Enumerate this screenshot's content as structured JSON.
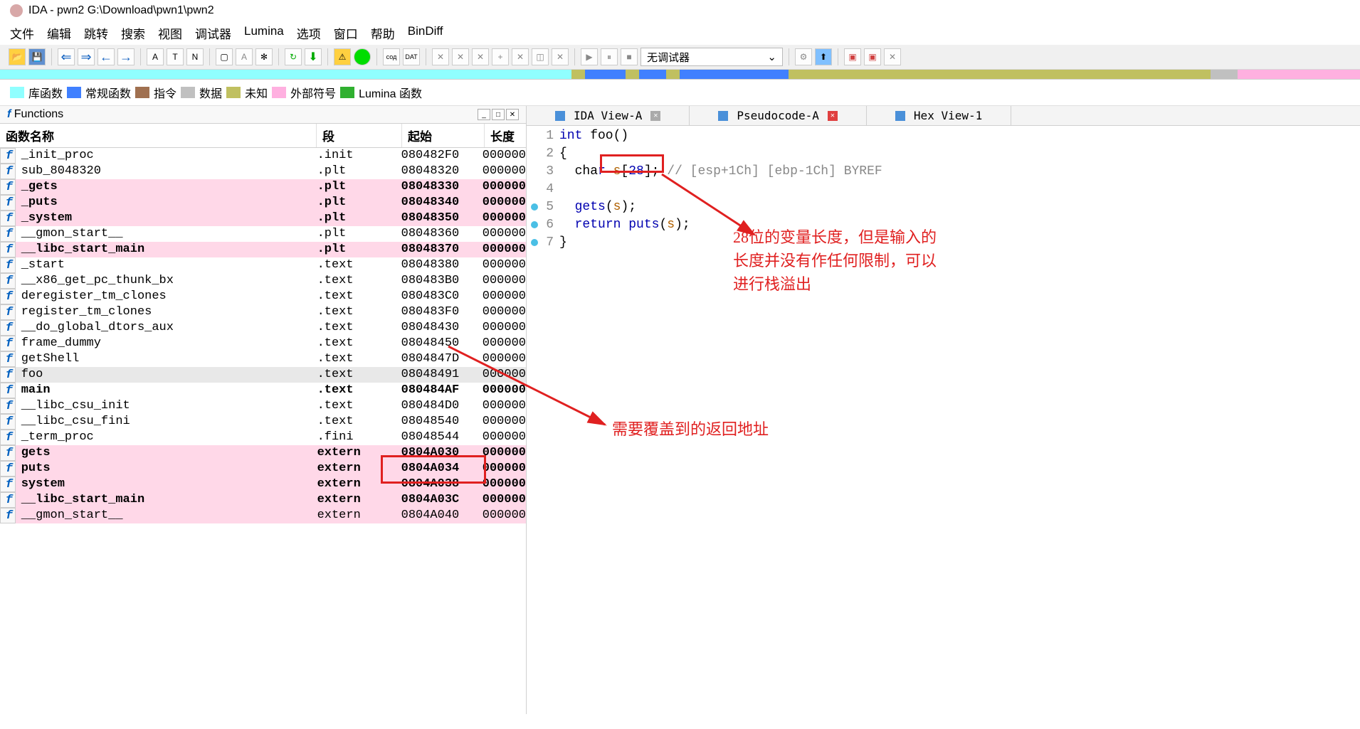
{
  "title": "IDA - pwn2 G:\\Download\\pwn1\\pwn2",
  "menu": [
    "文件",
    "编辑",
    "跳转",
    "搜索",
    "视图",
    "调试器",
    "Lumina",
    "选项",
    "窗口",
    "帮助",
    "BinDiff"
  ],
  "debugger_select": "无调试器",
  "legend": [
    {
      "color": "#90ffff",
      "label": "库函数"
    },
    {
      "color": "#4080ff",
      "label": "常规函数"
    },
    {
      "color": "#a07050",
      "label": "指令"
    },
    {
      "color": "#c0c0c0",
      "label": "数据"
    },
    {
      "color": "#c0c060",
      "label": "未知"
    },
    {
      "color": "#ffb0e0",
      "label": "外部符号"
    },
    {
      "color": "#30b030",
      "label": "Lumina 函数"
    }
  ],
  "functions_panel": {
    "title": "Functions",
    "headers": {
      "name": "函数名称",
      "seg": "段",
      "start": "起始",
      "len": "长度"
    }
  },
  "functions": [
    {
      "name": "_init_proc",
      "seg": ".init",
      "start": "080482F0",
      "len": "000000",
      "pink": false,
      "bold": false
    },
    {
      "name": "sub_8048320",
      "seg": ".plt",
      "start": "08048320",
      "len": "000000",
      "pink": false,
      "bold": false
    },
    {
      "name": "_gets",
      "seg": ".plt",
      "start": "08048330",
      "len": "000000",
      "pink": true,
      "bold": true
    },
    {
      "name": "_puts",
      "seg": ".plt",
      "start": "08048340",
      "len": "000000",
      "pink": true,
      "bold": true
    },
    {
      "name": "_system",
      "seg": ".plt",
      "start": "08048350",
      "len": "000000",
      "pink": true,
      "bold": true
    },
    {
      "name": "__gmon_start__",
      "seg": ".plt",
      "start": "08048360",
      "len": "000000",
      "pink": false,
      "bold": false
    },
    {
      "name": "__libc_start_main",
      "seg": ".plt",
      "start": "08048370",
      "len": "000000",
      "pink": true,
      "bold": true
    },
    {
      "name": "_start",
      "seg": ".text",
      "start": "08048380",
      "len": "000000",
      "pink": false,
      "bold": false
    },
    {
      "name": "__x86_get_pc_thunk_bx",
      "seg": ".text",
      "start": "080483B0",
      "len": "000000",
      "pink": false,
      "bold": false
    },
    {
      "name": "deregister_tm_clones",
      "seg": ".text",
      "start": "080483C0",
      "len": "000000",
      "pink": false,
      "bold": false
    },
    {
      "name": "register_tm_clones",
      "seg": ".text",
      "start": "080483F0",
      "len": "000000",
      "pink": false,
      "bold": false
    },
    {
      "name": "__do_global_dtors_aux",
      "seg": ".text",
      "start": "08048430",
      "len": "000000",
      "pink": false,
      "bold": false
    },
    {
      "name": "frame_dummy",
      "seg": ".text",
      "start": "08048450",
      "len": "000000",
      "pink": false,
      "bold": false
    },
    {
      "name": "getShell",
      "seg": ".text",
      "start": "0804847D",
      "len": "000000",
      "pink": false,
      "bold": false
    },
    {
      "name": "foo",
      "seg": ".text",
      "start": "08048491",
      "len": "000000",
      "pink": false,
      "bold": false,
      "sel": true
    },
    {
      "name": "main",
      "seg": ".text",
      "start": "080484AF",
      "len": "000000",
      "pink": false,
      "bold": true
    },
    {
      "name": "__libc_csu_init",
      "seg": ".text",
      "start": "080484D0",
      "len": "000000",
      "pink": false,
      "bold": false
    },
    {
      "name": "__libc_csu_fini",
      "seg": ".text",
      "start": "08048540",
      "len": "000000",
      "pink": false,
      "bold": false
    },
    {
      "name": "_term_proc",
      "seg": ".fini",
      "start": "08048544",
      "len": "000000",
      "pink": false,
      "bold": false
    },
    {
      "name": "gets",
      "seg": "extern",
      "start": "0804A030",
      "len": "000000",
      "pink": true,
      "bold": true
    },
    {
      "name": "puts",
      "seg": "extern",
      "start": "0804A034",
      "len": "000000",
      "pink": true,
      "bold": true
    },
    {
      "name": "system",
      "seg": "extern",
      "start": "0804A038",
      "len": "000000",
      "pink": true,
      "bold": true
    },
    {
      "name": "__libc_start_main",
      "seg": "extern",
      "start": "0804A03C",
      "len": "000000",
      "pink": true,
      "bold": true
    },
    {
      "name": "__gmon_start__",
      "seg": "extern",
      "start": "0804A040",
      "len": "000000",
      "pink": true,
      "bold": false
    }
  ],
  "tabs": [
    {
      "label": "IDA View-A",
      "close": "gray"
    },
    {
      "label": "Pseudocode-A",
      "close": "red"
    },
    {
      "label": "Hex View-1",
      "close": "none"
    }
  ],
  "code": {
    "l1": {
      "t1": "int",
      "t2": " foo()"
    },
    "l2": "{",
    "l3": {
      "t1": "  cha",
      "t2": "r",
      "t3": " s",
      "t4": "[",
      "t5": "28",
      "t6": "]; ",
      "c1": "// [esp+1Ch] [ebp-1Ch] BYREF"
    },
    "l4": "",
    "l5": {
      "t1": "  gets",
      "t2": "(",
      "t3": "s",
      "t4": ");"
    },
    "l6": {
      "t1": "  ",
      "t2": "return",
      "t3": " puts",
      "t4": "(",
      "t5": "s",
      "t6": ");"
    },
    "l7": "}"
  },
  "annot1": "28位的变量长度，但是输入的\n长度并没有作任何限制，可以\n进行栈溢出",
  "annot2": "需要覆盖到的返回地址"
}
